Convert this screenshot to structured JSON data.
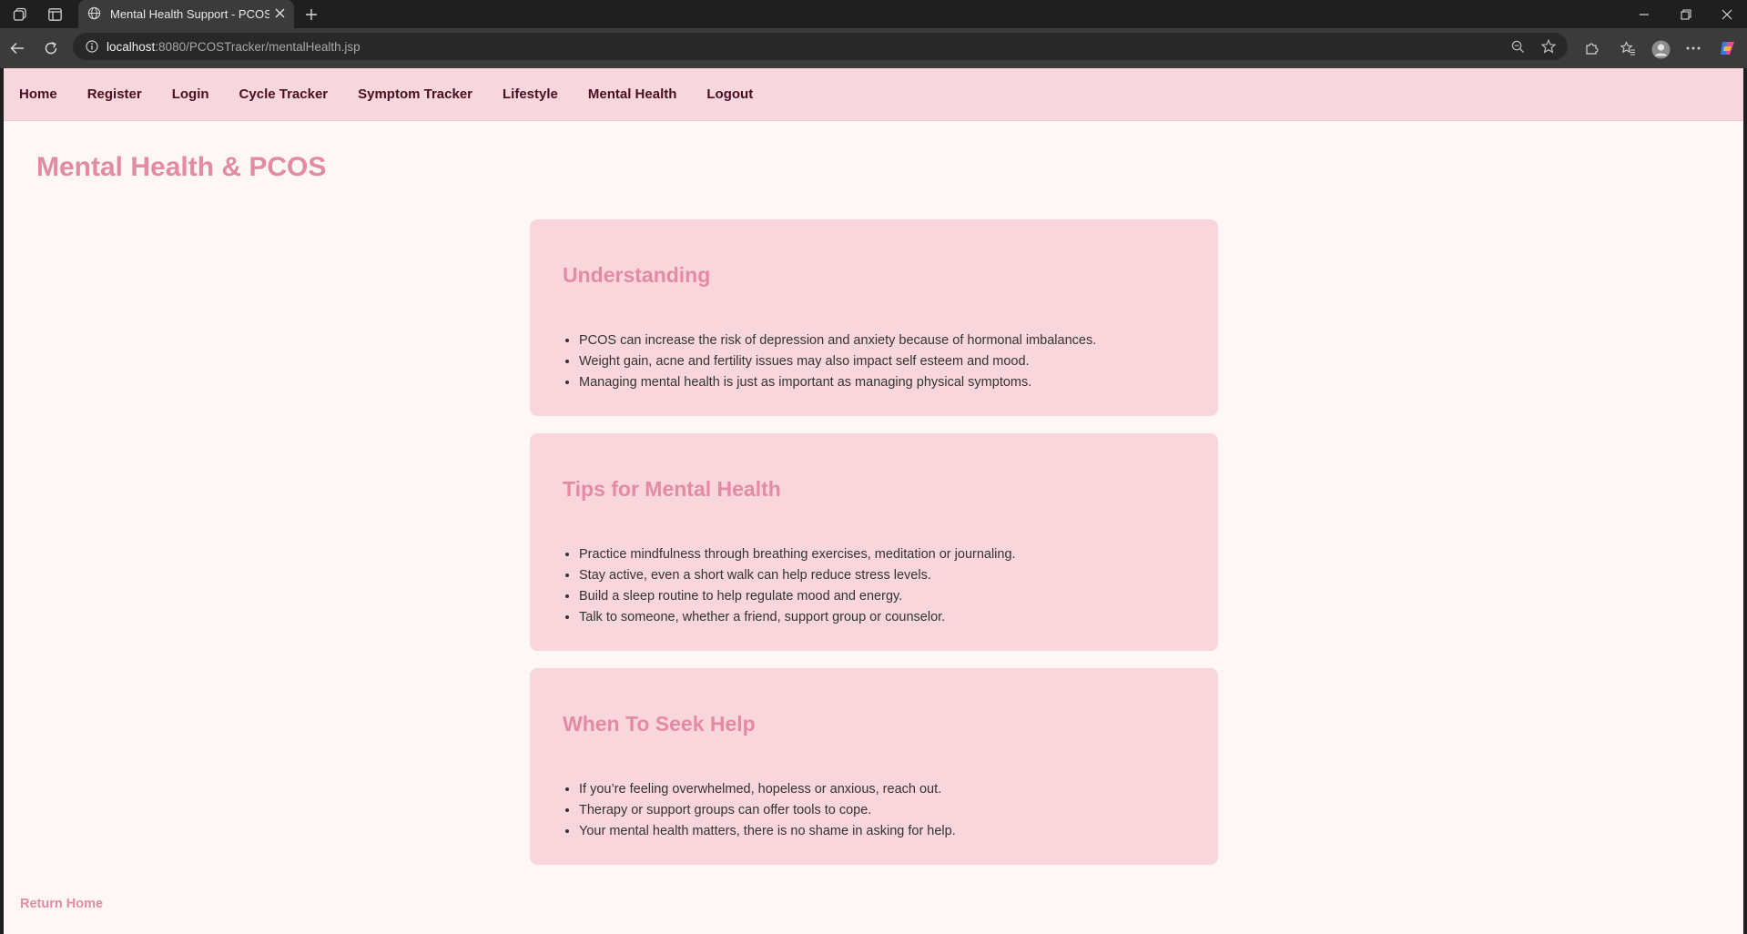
{
  "browser": {
    "tab_title": "Mental Health Support - PCOS Tracker",
    "url_host": "localhost",
    "url_rest": ":8080/PCOSTracker/mentalHealth.jsp"
  },
  "nav": {
    "items": [
      {
        "label": "Home"
      },
      {
        "label": "Register"
      },
      {
        "label": "Login"
      },
      {
        "label": "Cycle Tracker"
      },
      {
        "label": "Symptom Tracker"
      },
      {
        "label": "Lifestyle"
      },
      {
        "label": "Mental Health"
      },
      {
        "label": "Logout"
      }
    ]
  },
  "page": {
    "title": "Mental Health & PCOS",
    "return_link": "Return Home"
  },
  "sections": [
    {
      "heading": "Understanding",
      "items": [
        "PCOS can increase the risk of depression and anxiety because of hormonal imbalances.",
        "Weight gain, acne and fertility issues may also impact self esteem and mood.",
        "Managing mental health is just as important as managing physical symptoms."
      ]
    },
    {
      "heading": "Tips for Mental Health",
      "items": [
        "Practice mindfulness through breathing exercises, meditation or journaling.",
        "Stay active, even a short walk can help reduce stress levels.",
        "Build a sleep routine to help regulate mood and energy.",
        "Talk to someone, whether a friend, support group or counselor."
      ]
    },
    {
      "heading": "When To Seek Help",
      "items": [
        "If you’re feeling overwhelmed, hopeless or anxious, reach out.",
        "Therapy or support groups can offer tools to cope.",
        "Your mental health matters, there is no shame in asking for help."
      ]
    }
  ],
  "colors": {
    "nav_bg": "#f8d6dd",
    "page_bg": "#fff7f7",
    "card_bg": "#f9d6dc",
    "accent": "#e38ba3",
    "nav_text": "#4a0d24"
  }
}
